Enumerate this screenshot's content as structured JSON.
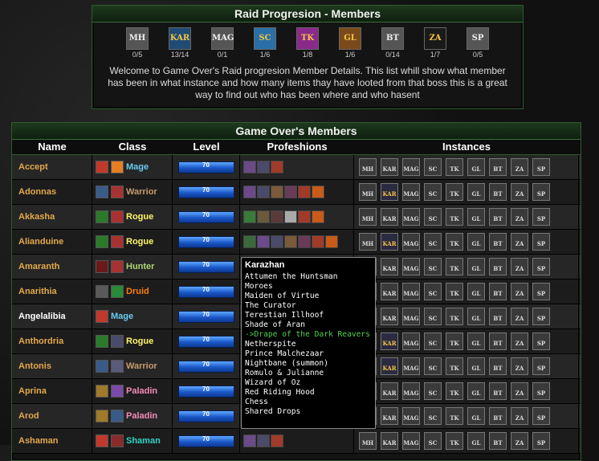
{
  "progression": {
    "title": "Raid Progresion - Members",
    "instances": [
      {
        "abbr": "MH",
        "count": "0/5",
        "color": "#555",
        "text": "#eee"
      },
      {
        "abbr": "KAR",
        "count": "13/14",
        "color": "#1f4b74",
        "text": "#f5c542"
      },
      {
        "abbr": "MAG",
        "count": "0/1",
        "color": "#555",
        "text": "#eee"
      },
      {
        "abbr": "SC",
        "count": "1/6",
        "color": "#2a6fa8",
        "text": "#f5c542"
      },
      {
        "abbr": "TK",
        "count": "1/8",
        "color": "#8a2a8a",
        "text": "#f5c542"
      },
      {
        "abbr": "GL",
        "count": "1/6",
        "color": "#7a4a1a",
        "text": "#f5c542"
      },
      {
        "abbr": "BT",
        "count": "0/14",
        "color": "#555",
        "text": "#eee"
      },
      {
        "abbr": "ZA",
        "count": "1/7",
        "color": "#1a1a1a",
        "text": "#f5c542"
      },
      {
        "abbr": "SP",
        "count": "0/5",
        "color": "#555",
        "text": "#eee"
      }
    ],
    "welcome": "Welcome to Game Over's Raid progresion Member Details. This list whill show what member has been in what instance and how many items thay have looted from that boss this is a great way to find out who has been where and who hasent"
  },
  "members_panel": {
    "title": "Game Over's Members",
    "headers": {
      "name": "Name",
      "class": "Class",
      "level": "Level",
      "prof": "Profeshions",
      "inst": "Instances"
    }
  },
  "members": [
    {
      "name": "Accept",
      "cls": "Mage",
      "cls_color": "#69ccf0",
      "level": "70",
      "spec": [
        "#c0392b",
        "#e67e22"
      ],
      "prof": [
        "#6b4a8a",
        "#4a4a6a",
        "#a23a2a"
      ],
      "kar": false,
      "white": false
    },
    {
      "name": "Adonnas",
      "cls": "Warrior",
      "cls_color": "#c79c6e",
      "level": "70",
      "spec": [
        "#3a5a8a",
        "#a83232"
      ],
      "prof": [
        "#6b4a8a",
        "#4a4a6a",
        "#7a5a3a",
        "#6a3a5a",
        "#a23a2a",
        "#c85a1a"
      ],
      "kar": true,
      "white": false
    },
    {
      "name": "Akkasha",
      "cls": "Rogue",
      "cls_color": "#fff569",
      "level": "70",
      "spec": [
        "#2a7a2a",
        "#a83232"
      ],
      "prof": [
        "#3a7a3a",
        "#6a5a3a",
        "#5a3a3a",
        "#aaaaaa",
        "#a23a2a",
        "#c85a1a"
      ],
      "kar": false,
      "white": false
    },
    {
      "name": "Alianduine",
      "cls": "Rogue",
      "cls_color": "#fff569",
      "level": "70",
      "spec": [
        "#2a7a2a",
        "#a83232"
      ],
      "prof": [
        "#3a6a3a",
        "#6b4a8a",
        "#4a4a6a",
        "#7a5a3a",
        "#6a3a5a",
        "#a23a2a",
        "#c85a1a"
      ],
      "kar": true,
      "white": false
    },
    {
      "name": "Amaranth",
      "cls": "Hunter",
      "cls_color": "#abd473",
      "level": "70",
      "spec": [
        "#6a1a1a",
        "#a83232"
      ],
      "prof": [
        "#6b4a8a",
        "#a23a2a",
        "#c85a1a"
      ],
      "kar": false,
      "white": false
    },
    {
      "name": "Anarithia",
      "cls": "Druid",
      "cls_color": "#ff7d0a",
      "level": "70",
      "spec": [
        "#5a5a5a",
        "#2a8a3a"
      ],
      "prof": [
        "#6b4a8a",
        "#a23a2a"
      ],
      "kar": false,
      "white": false
    },
    {
      "name": "Angelalibia",
      "cls": "Mage",
      "cls_color": "#69ccf0",
      "level": "70",
      "spec": [
        "#c0392b"
      ],
      "prof": [
        "#a23a2a"
      ],
      "kar": false,
      "white": true
    },
    {
      "name": "Anthordria",
      "cls": "Rogue",
      "cls_color": "#fff569",
      "level": "70",
      "spec": [
        "#2a7a2a",
        "#4a4a6a"
      ],
      "prof": [
        "#6b4a8a",
        "#a23a2a"
      ],
      "kar": true,
      "white": false
    },
    {
      "name": "Antonis",
      "cls": "Warrior",
      "cls_color": "#c79c6e",
      "level": "70",
      "spec": [
        "#3a5a8a",
        "#5a5a7a"
      ],
      "prof": [
        "#6b4a8a",
        "#a23a2a"
      ],
      "kar": true,
      "white": false
    },
    {
      "name": "Aprina",
      "cls": "Paladin",
      "cls_color": "#f58cba",
      "level": "70",
      "spec": [
        "#a07a2a",
        "#7a4aa8"
      ],
      "prof": [
        "#6b4a8a",
        "#a23a2a"
      ],
      "kar": false,
      "white": false
    },
    {
      "name": "Arod",
      "cls": "Paladin",
      "cls_color": "#f58cba",
      "level": "70",
      "spec": [
        "#a07a2a",
        "#3a5a8a"
      ],
      "prof": [
        "#6b4a8a",
        "#a23a2a"
      ],
      "kar": false,
      "white": false
    },
    {
      "name": "Ashaman",
      "cls": "Shaman",
      "cls_color": "#2fd4c4",
      "level": "70",
      "spec": [
        "#c0392b",
        "#8a2a2a"
      ],
      "prof": [
        "#6b4a8a",
        "#4a4a6a",
        "#a23a2a"
      ],
      "kar": false,
      "white": false
    }
  ],
  "instance_cols": [
    "MH",
    "KAR",
    "MAG",
    "SC",
    "TK",
    "GL",
    "BT",
    "ZA",
    "SP"
  ],
  "tooltip": {
    "title": "Karazhan",
    "items": [
      {
        "text": "Attumen the Huntsman",
        "loot": false
      },
      {
        "text": "Moroes",
        "loot": false
      },
      {
        "text": "Maiden of Virtue",
        "loot": false
      },
      {
        "text": "The Curator",
        "loot": false
      },
      {
        "text": "Terestian Illhoof",
        "loot": false
      },
      {
        "text": "Shade of Aran",
        "loot": false
      },
      {
        "text": "->Drape of the Dark Reavers",
        "loot": true
      },
      {
        "text": "Netherspite",
        "loot": false
      },
      {
        "text": "Prince Malchezaar",
        "loot": false
      },
      {
        "text": "Nightbane (summon)",
        "loot": false
      },
      {
        "text": "Romulo & Julianne",
        "loot": false
      },
      {
        "text": "Wizard of Oz",
        "loot": false
      },
      {
        "text": "Red Riding Hood",
        "loot": false
      },
      {
        "text": "Chess",
        "loot": false
      },
      {
        "text": "Shared Drops",
        "loot": false
      }
    ]
  }
}
